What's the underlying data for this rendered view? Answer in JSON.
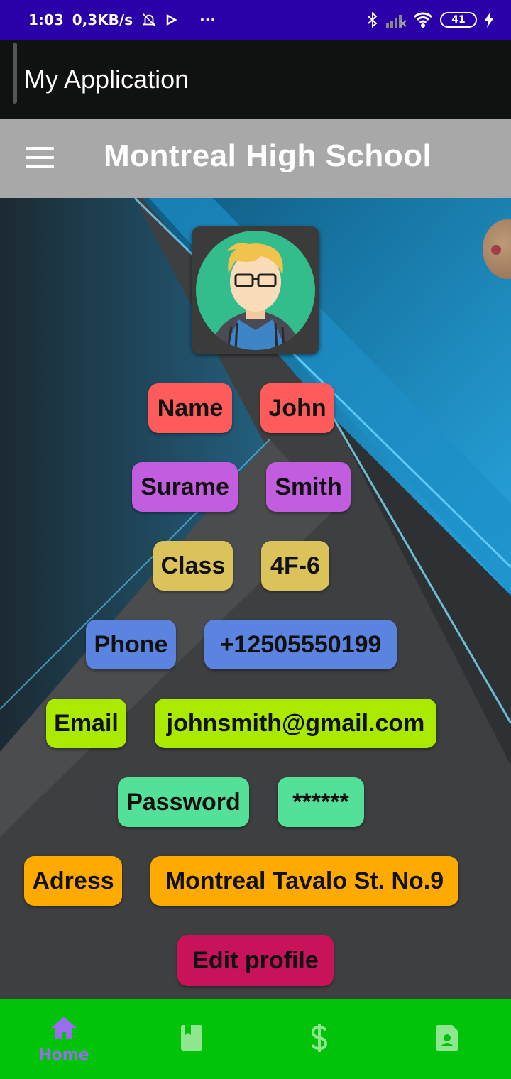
{
  "status_bar": {
    "time": "1:03",
    "speed": "0,3KB/s",
    "more": "···",
    "battery": "41"
  },
  "app_bar": {
    "title": "My Application"
  },
  "toolbar": {
    "title": "Montreal High School",
    "menu_icon": "menu-icon"
  },
  "profile": {
    "rows": [
      {
        "label": "Name",
        "value": "John",
        "color": "#ff5b5b"
      },
      {
        "label": "Surame",
        "value": "Smith",
        "color": "#c25de0"
      },
      {
        "label": "Class",
        "value": "4F-6",
        "color": "#dcc25a"
      },
      {
        "label": "Phone",
        "value": "+12505550199",
        "color": "#5b84e0"
      },
      {
        "label": "Email",
        "value": "johnsmith@gmail.com",
        "color": "#aaea00"
      },
      {
        "label": "Password",
        "value": "******",
        "color": "#55e09a"
      },
      {
        "label": "Adress",
        "value": "Montreal Tavalo St. No.9",
        "color": "#ffaa00"
      }
    ],
    "edit_button": "Edit profile",
    "edit_color": "#c8135a"
  },
  "bottom_nav": {
    "background": "#00c30a",
    "items": [
      {
        "icon": "home-icon",
        "label": "Home",
        "active": true
      },
      {
        "icon": "book-icon",
        "label": ""
      },
      {
        "icon": "dollar-icon",
        "label": ""
      },
      {
        "icon": "contact-card-icon",
        "label": ""
      }
    ]
  }
}
